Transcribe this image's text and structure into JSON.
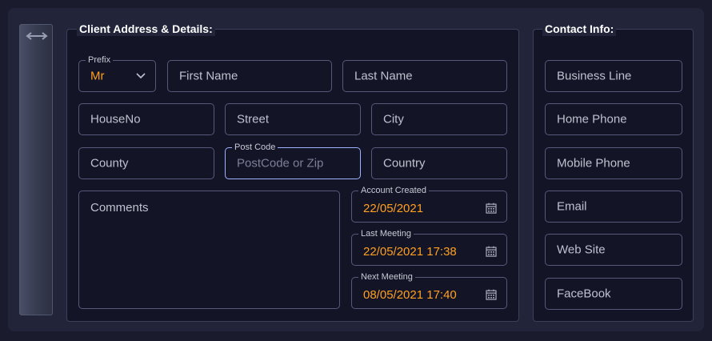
{
  "client": {
    "legend": "Client Address & Details:",
    "prefix": {
      "label": "Prefix",
      "value": "Mr"
    },
    "first_name": {
      "placeholder": "First Name"
    },
    "last_name": {
      "placeholder": "Last Name"
    },
    "house_no": {
      "placeholder": "HouseNo"
    },
    "street": {
      "placeholder": "Street"
    },
    "city": {
      "placeholder": "City"
    },
    "county": {
      "placeholder": "County"
    },
    "post_code": {
      "label": "Post Code",
      "placeholder": "PostCode or Zip"
    },
    "country": {
      "placeholder": "Country"
    },
    "comments": {
      "placeholder": "Comments"
    },
    "account_created": {
      "label": "Account Created",
      "value": "22/05/2021"
    },
    "last_meeting": {
      "label": "Last Meeting",
      "value": "22/05/2021 17:38"
    },
    "next_meeting": {
      "label": "Next Meeting",
      "value": "08/05/2021 17:40"
    }
  },
  "contact": {
    "legend": "Contact Info:",
    "business_line": {
      "placeholder": "Business Line"
    },
    "home_phone": {
      "placeholder": "Home Phone"
    },
    "mobile_phone": {
      "placeholder": "Mobile Phone"
    },
    "email": {
      "placeholder": "Email"
    },
    "web_site": {
      "placeholder": "Web Site"
    },
    "facebook": {
      "placeholder": "FaceBook"
    }
  },
  "colors": {
    "background": "#1a1b2c",
    "panel": "#22253a",
    "field_border": "#56597a",
    "focus_border": "#9fb2ff",
    "value_accent": "#ffa020"
  },
  "icons": {
    "handle": "resize-horizontal-icon",
    "dropdown": "chevron-down-icon",
    "date": "calendar-icon"
  }
}
